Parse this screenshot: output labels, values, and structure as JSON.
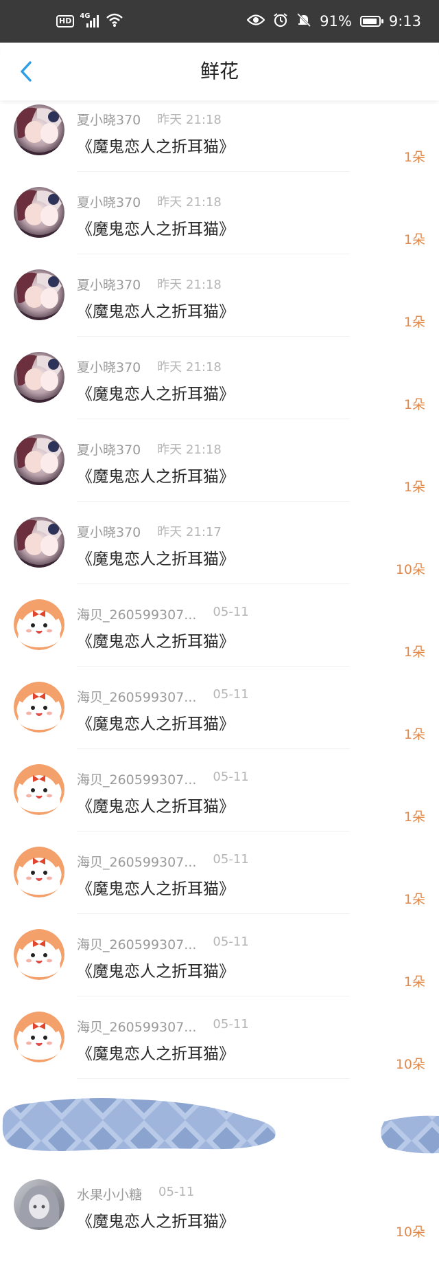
{
  "status_bar": {
    "hd": "HD",
    "network": "4G",
    "battery": "91%",
    "battery_level": 0.91,
    "time": "9:13"
  },
  "header": {
    "title": "鲜花",
    "back_icon": "chevron-left-icon"
  },
  "colors": {
    "accent": "#2f9ee8",
    "count": "#e0894a",
    "status_bar": "#3a3a3a"
  },
  "items": [
    {
      "user": "夏小晓370",
      "time": "昨天 21:18",
      "book": "《魔鬼恋人之折耳猫》",
      "count": "1朵",
      "avatar": "anime-girls-avatar"
    },
    {
      "user": "夏小晓370",
      "time": "昨天 21:18",
      "book": "《魔鬼恋人之折耳猫》",
      "count": "1朵",
      "avatar": "anime-girls-avatar"
    },
    {
      "user": "夏小晓370",
      "time": "昨天 21:18",
      "book": "《魔鬼恋人之折耳猫》",
      "count": "1朵",
      "avatar": "anime-girls-avatar"
    },
    {
      "user": "夏小晓370",
      "time": "昨天 21:18",
      "book": "《魔鬼恋人之折耳猫》",
      "count": "1朵",
      "avatar": "anime-girls-avatar"
    },
    {
      "user": "夏小晓370",
      "time": "昨天 21:18",
      "book": "《魔鬼恋人之折耳猫》",
      "count": "1朵",
      "avatar": "anime-girls-avatar"
    },
    {
      "user": "夏小晓370",
      "time": "昨天 21:17",
      "book": "《魔鬼恋人之折耳猫》",
      "count": "10朵",
      "avatar": "anime-girls-avatar"
    },
    {
      "user": "海贝_260599307...",
      "time": "05-11",
      "book": "《魔鬼恋人之折耳猫》",
      "count": "1朵",
      "avatar": "puppy-avatar"
    },
    {
      "user": "海贝_260599307...",
      "time": "05-11",
      "book": "《魔鬼恋人之折耳猫》",
      "count": "1朵",
      "avatar": "puppy-avatar"
    },
    {
      "user": "海贝_260599307...",
      "time": "05-11",
      "book": "《魔鬼恋人之折耳猫》",
      "count": "1朵",
      "avatar": "puppy-avatar"
    },
    {
      "user": "海贝_260599307...",
      "time": "05-11",
      "book": "《魔鬼恋人之折耳猫》",
      "count": "1朵",
      "avatar": "puppy-avatar"
    },
    {
      "user": "海贝_260599307...",
      "time": "05-11",
      "book": "《魔鬼恋人之折耳猫》",
      "count": "1朵",
      "avatar": "puppy-avatar"
    },
    {
      "user": "海贝_260599307...",
      "time": "05-11",
      "book": "《魔鬼恋人之折耳猫》",
      "count": "10朵",
      "avatar": "puppy-avatar"
    }
  ],
  "last_item": {
    "user": "水果小小糖",
    "time": "05-11",
    "book": "《魔鬼恋人之折耳猫》",
    "count": "10朵",
    "avatar": "gray-hair-girl-avatar"
  }
}
